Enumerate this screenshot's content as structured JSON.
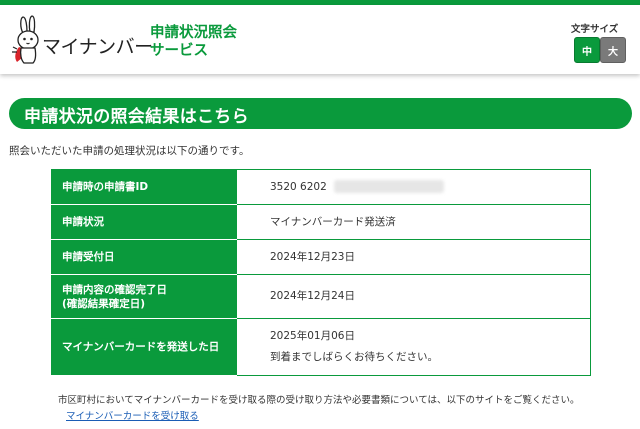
{
  "header": {
    "logo_text": "マイナンバー",
    "service_title_line1": "申請状況照会",
    "service_title_line2": "サービス",
    "font_size_label": "文字サイズ",
    "font_size_medium": "中",
    "font_size_large": "大",
    "font_size_selected": "中"
  },
  "banner": {
    "title": "申請状況の照会結果はこちら"
  },
  "intro_text": "照会いただいた申請の処理状況は以下の通りです。",
  "results": {
    "rows": [
      {
        "label": "申請時の申請書ID",
        "value": "3520 6202"
      },
      {
        "label": "申請状況",
        "value": "マイナンバーカード発送済"
      },
      {
        "label": "申請受付日",
        "value": "2024年12月23日"
      },
      {
        "label_line1": "申請内容の確認完了日",
        "label_line2": "(確認結果確定日)",
        "value": "2024年12月24日"
      },
      {
        "label": "マイナンバーカードを発送した日",
        "value": "2025年01月06日",
        "value_note": "到着までしばらくお待ちください。"
      }
    ]
  },
  "footer": {
    "note": "市区町村においてマイナンバーカードを受け取る際の受け取り方法や必要書類については、以下のサイトをご覧ください。",
    "link_text": "マイナンバーカードを受け取る"
  },
  "colors": {
    "brand_green": "#0a9a3c",
    "link_blue": "#1a5db5",
    "inactive_gray": "#7a7a7a"
  }
}
